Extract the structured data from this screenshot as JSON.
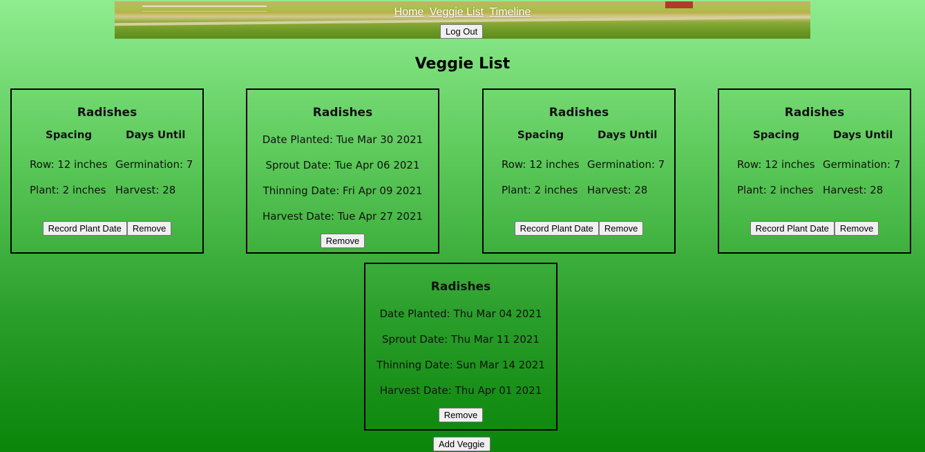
{
  "nav": {
    "home": "Home",
    "veggie_list": "Veggie List",
    "timeline": "Timeline",
    "logout": "Log Out"
  },
  "page_title": "Veggie List",
  "cards": [
    {
      "name": "Radishes",
      "spacing_header": "Spacing",
      "days_header": "Days Until",
      "row": "Row: 12 inches",
      "plant": "Plant: 2 inches",
      "germination": "Germination: 7",
      "harvest": "Harvest: 28",
      "record_label": "Record Plant Date",
      "remove_label": "Remove"
    },
    {
      "name": "Radishes",
      "date_planted": "Date Planted: Tue Mar 30 2021",
      "sprout_date": "Sprout Date: Tue Apr 06 2021",
      "thinning_date": "Thinning Date: Fri Apr 09 2021",
      "harvest_date": "Harvest Date: Tue Apr 27 2021",
      "remove_label": "Remove"
    },
    {
      "name": "Radishes",
      "spacing_header": "Spacing",
      "days_header": "Days Until",
      "row": "Row: 12 inches",
      "plant": "Plant: 2 inches",
      "germination": "Germination: 7",
      "harvest": "Harvest: 28",
      "record_label": "Record Plant Date",
      "remove_label": "Remove"
    },
    {
      "name": "Radishes",
      "spacing_header": "Spacing",
      "days_header": "Days Until",
      "row": "Row: 12 inches",
      "plant": "Plant: 2 inches",
      "germination": "Germination: 7",
      "harvest": "Harvest: 28",
      "record_label": "Record Plant Date",
      "remove_label": "Remove"
    },
    {
      "name": "Radishes",
      "date_planted": "Date Planted: Thu Mar 04 2021",
      "sprout_date": "Sprout Date: Thu Mar 11 2021",
      "thinning_date": "Thinning Date: Sun Mar 14 2021",
      "harvest_date": "Harvest Date: Thu Apr 01 2021",
      "remove_label": "Remove"
    }
  ],
  "add_veggie_label": "Add Veggie"
}
